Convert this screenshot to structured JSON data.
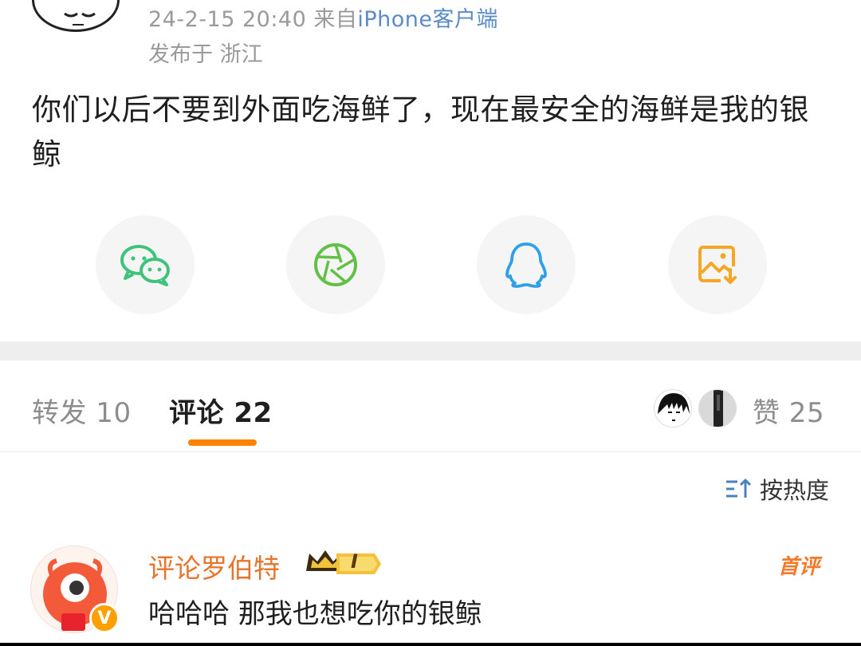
{
  "post": {
    "timestamp": "24-2-15 20:40",
    "source_prefix": "来自",
    "source_client": "iPhone客户端",
    "location": "发布于 浙江",
    "text": "你们以后不要到外面吃海鲜了，现在最安全的海鲜是我的银鲸"
  },
  "share": [
    {
      "icon": "wechat-icon",
      "color": "#3fc37a"
    },
    {
      "icon": "moments-icon",
      "color": "#62c046"
    },
    {
      "icon": "qq-icon",
      "color": "#2f9fe8"
    },
    {
      "icon": "save-image-icon",
      "color": "#f5a623"
    }
  ],
  "tabs": {
    "repost": "转发 10",
    "comment": "评论 22",
    "like": "赞 25"
  },
  "sort": {
    "label": "按热度"
  },
  "comment": {
    "user": "评论罗伯特",
    "level": "I",
    "text": "哈哈哈 那我也想吃你的银鲸",
    "badge": "首评",
    "verified": "V"
  },
  "colors": {
    "accent": "#ff8200",
    "username": "#e8732c",
    "link": "#5a8bc8"
  }
}
